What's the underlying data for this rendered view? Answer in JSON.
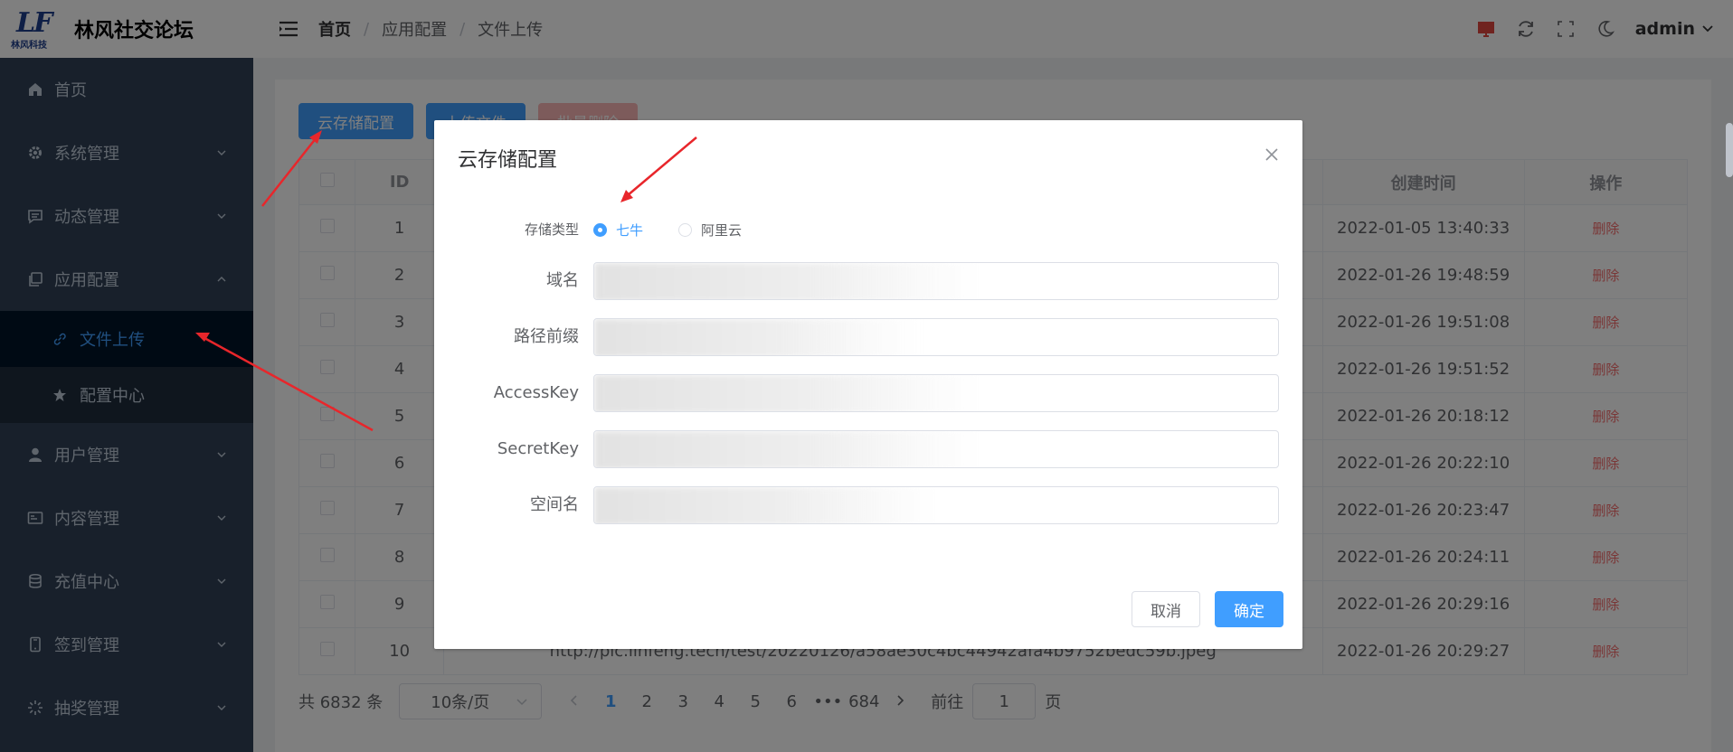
{
  "brand": {
    "logo_text": "LF",
    "logo_sub": "林风科技",
    "title": "林风社交论坛"
  },
  "sidebar": {
    "items": [
      {
        "label": "首页",
        "icon": "home-icon",
        "expandable": false
      },
      {
        "label": "系统管理",
        "icon": "gear-icon",
        "expandable": true
      },
      {
        "label": "动态管理",
        "icon": "message-icon",
        "expandable": true
      },
      {
        "label": "应用配置",
        "icon": "copy-icon",
        "expandable": true,
        "expanded": true,
        "children": [
          {
            "label": "文件上传",
            "icon": "link-icon",
            "active": true
          },
          {
            "label": "配置中心",
            "icon": "star-icon",
            "active": false
          }
        ]
      },
      {
        "label": "用户管理",
        "icon": "user-icon",
        "expandable": true
      },
      {
        "label": "内容管理",
        "icon": "card-icon",
        "expandable": true
      },
      {
        "label": "充值中心",
        "icon": "database-icon",
        "expandable": true
      },
      {
        "label": "签到管理",
        "icon": "phone-icon",
        "expandable": true
      },
      {
        "label": "抽奖管理",
        "icon": "sunburst-icon",
        "expandable": true
      }
    ]
  },
  "header": {
    "breadcrumb": [
      "首页",
      "应用配置",
      "文件上传"
    ],
    "user": "admin"
  },
  "toolbar": {
    "cloud_config": "云存储配置",
    "upload": "上传文件",
    "batch_delete": "批量删除"
  },
  "table": {
    "columns": [
      "ID",
      "创建时间",
      "操作"
    ],
    "rows": [
      {
        "id": "1",
        "time": "2022-01-05 13:40:33",
        "action": "删除"
      },
      {
        "id": "2",
        "time": "2022-01-26 19:48:59",
        "action": "删除"
      },
      {
        "id": "3",
        "time": "2022-01-26 19:51:08",
        "action": "删除"
      },
      {
        "id": "4",
        "time": "2022-01-26 19:51:52",
        "action": "删除"
      },
      {
        "id": "5",
        "time": "2022-01-26 20:18:12",
        "action": "删除"
      },
      {
        "id": "6",
        "time": "2022-01-26 20:22:10",
        "action": "删除"
      },
      {
        "id": "7",
        "time": "2022-01-26 20:23:47",
        "action": "删除"
      },
      {
        "id": "8",
        "time": "2022-01-26 20:24:11",
        "action": "删除"
      },
      {
        "id": "9",
        "time": "2022-01-26 20:29:16",
        "action": "删除"
      },
      {
        "id": "10",
        "time": "2022-01-26 20:29:27",
        "action": "删除",
        "url": "http://pic.linfeng.tech/test/20220126/a58ae30c4bc44942afa4b9752bedc59b.jpeg"
      }
    ]
  },
  "pagination": {
    "total": "共 6832 条",
    "page_size": "10条/页",
    "pages": [
      "1",
      "2",
      "3",
      "4",
      "5",
      "6",
      "•••",
      "684"
    ],
    "current": "1",
    "goto_label": "前往",
    "goto_value": "1",
    "goto_suffix": "页"
  },
  "dialog": {
    "title": "云存储配置",
    "storage_type_label": "存储类型",
    "options": [
      {
        "label": "七牛",
        "checked": true
      },
      {
        "label": "阿里云",
        "checked": false
      }
    ],
    "fields": [
      {
        "label": "域名",
        "value": ""
      },
      {
        "label": "路径前缀",
        "value": ""
      },
      {
        "label": "AccessKey",
        "value": ""
      },
      {
        "label": "SecretKey",
        "value": ""
      },
      {
        "label": "空间名",
        "value": ""
      }
    ],
    "cancel": "取消",
    "confirm": "确定"
  },
  "colors": {
    "primary": "#409eff",
    "danger": "#f56c6c",
    "sidebar_bg": "#304156",
    "annotation": "#e8262b"
  }
}
